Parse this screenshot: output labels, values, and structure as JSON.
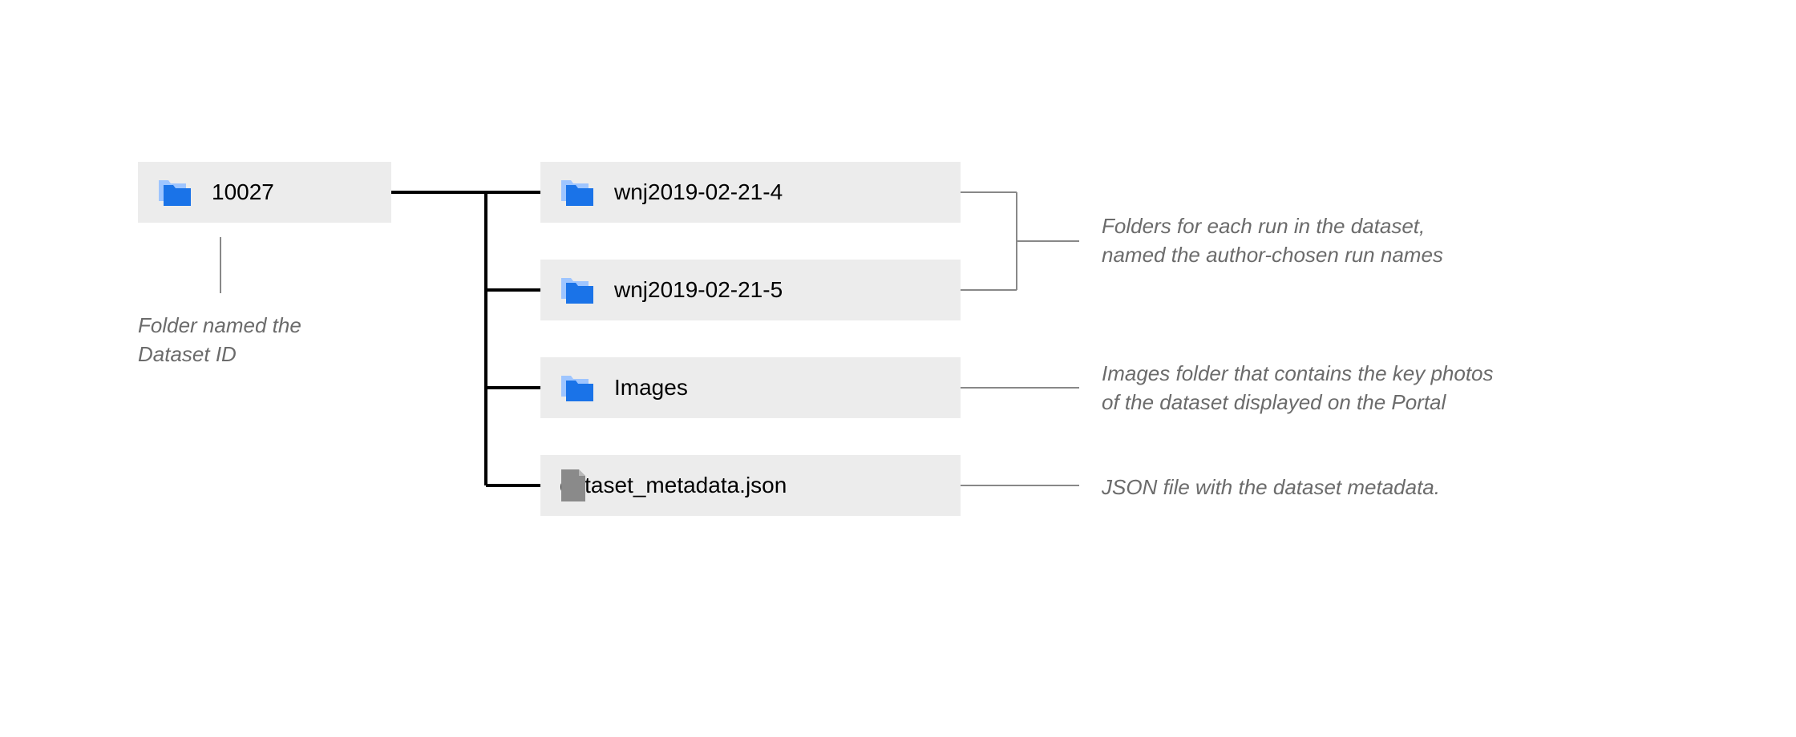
{
  "root": {
    "label": "10027",
    "annotation": "Folder named the\nDataset ID"
  },
  "children": [
    {
      "type": "folder",
      "label": "wnj2019-02-21-4"
    },
    {
      "type": "folder",
      "label": "wnj2019-02-21-5"
    },
    {
      "type": "folder",
      "label": "Images"
    },
    {
      "type": "file",
      "label": "dataset_metadata.json"
    }
  ],
  "annotations": {
    "runs": "Folders for each run in the dataset,\nnamed the author-chosen run names",
    "images": "Images folder that contains the key photos\nof the dataset displayed on the Portal",
    "metadata": "JSON file with the dataset metadata."
  }
}
